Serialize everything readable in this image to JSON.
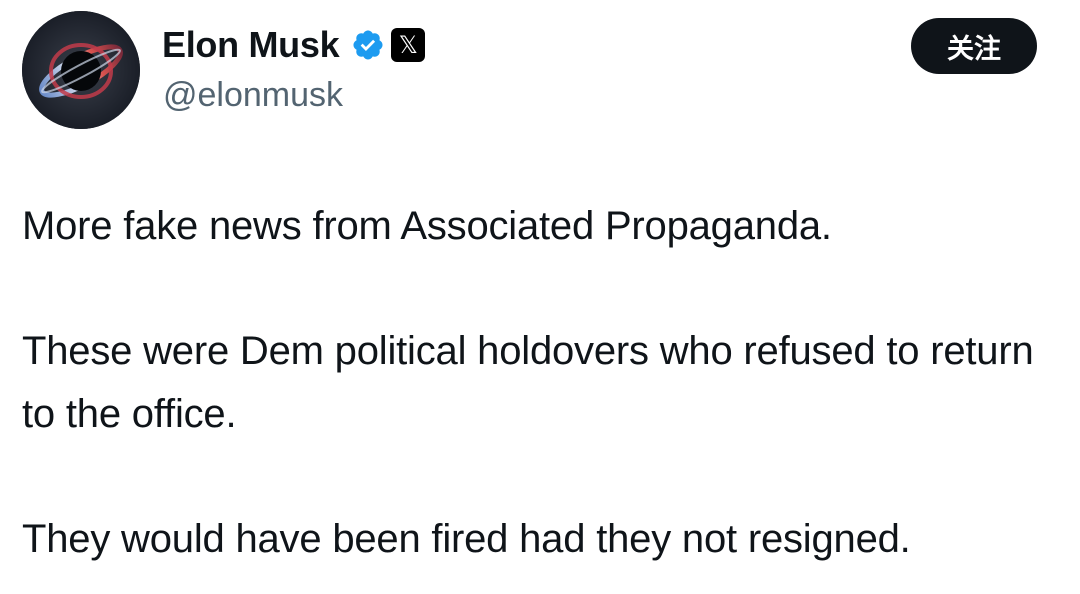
{
  "profile": {
    "display_name": "Elon Musk",
    "handle": "@elonmusk",
    "verified_icon": "verified-badge-icon",
    "verified_color": "#1d9bf0",
    "platform_badge_glyph": "𝕏",
    "avatar_icon": "black-hole-avatar"
  },
  "follow_button": {
    "label": "关注"
  },
  "tweet": {
    "paragraphs": [
      "More fake news from Associated Propaganda.",
      "These were Dem political holdovers who refused to return to the office.",
      "They would have been fired had they not resigned."
    ]
  },
  "colors": {
    "text_primary": "#0f1419",
    "text_secondary": "#536471",
    "button_bg": "#0f1419",
    "button_text": "#ffffff"
  }
}
